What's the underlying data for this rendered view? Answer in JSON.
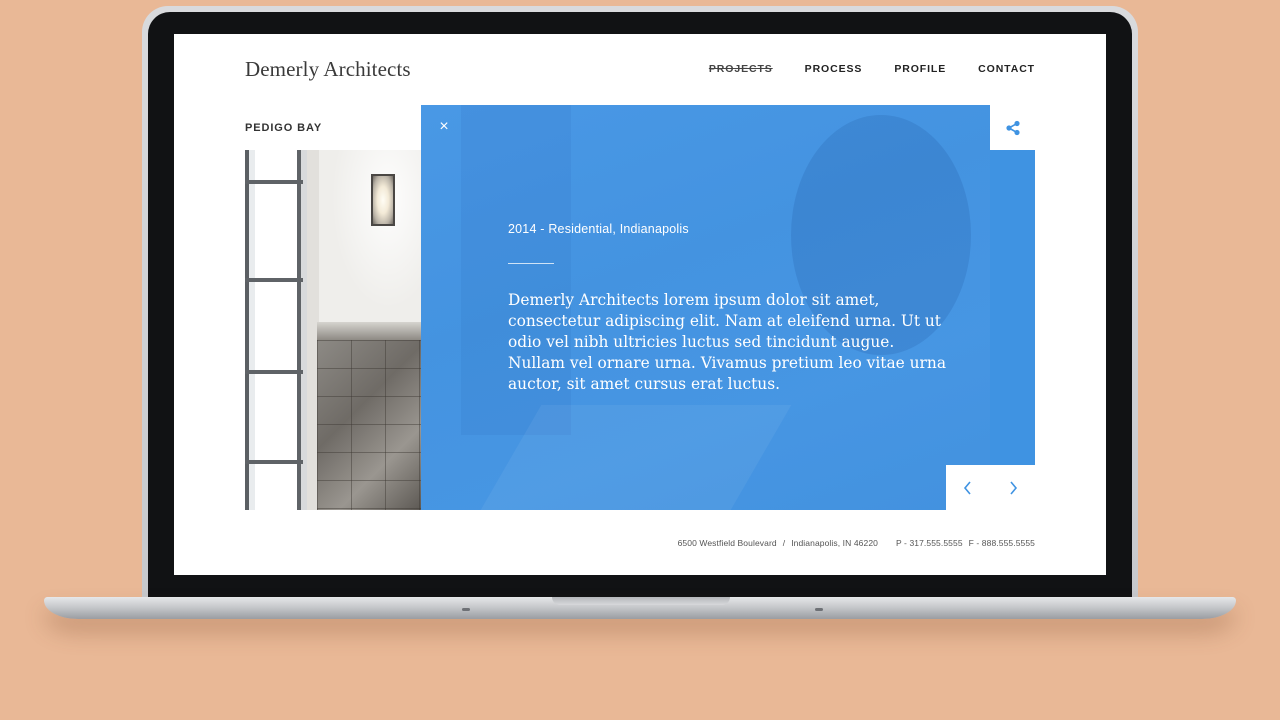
{
  "site": {
    "logo": "Demerly Architects",
    "nav": [
      {
        "label": "PROJECTS",
        "current": true
      },
      {
        "label": "PROCESS",
        "current": false
      },
      {
        "label": "PROFILE",
        "current": false
      },
      {
        "label": "CONTACT",
        "current": false
      }
    ]
  },
  "project": {
    "title": "PEDIGO BAY",
    "meta": "2014 - Residential, Indianapolis",
    "description": "Demerly Architects lorem ipsum dolor sit amet, consectetur adipiscing elit. Nam at eleifend urna. Ut ut odio vel nibh ultricies luctus sed tincidunt augue. Nullam vel ornare urna. Vivamus pretium leo vitae urna auctor, sit amet cursus erat luctus.",
    "close_symbol": "×"
  },
  "footer": {
    "address": "6500 Westfield Boulevard",
    "separator": "/",
    "city": "Indianapolis, IN 46220",
    "phone": "P - 317.555.5555",
    "fax": "F - 888.555.5555"
  },
  "icons": {
    "close": "close-icon",
    "share": "share-icon",
    "prev": "chevron-left-icon",
    "next": "chevron-right-icon"
  },
  "colors": {
    "background": "#e9b896",
    "accent": "#4296e8",
    "text": "#222222"
  }
}
